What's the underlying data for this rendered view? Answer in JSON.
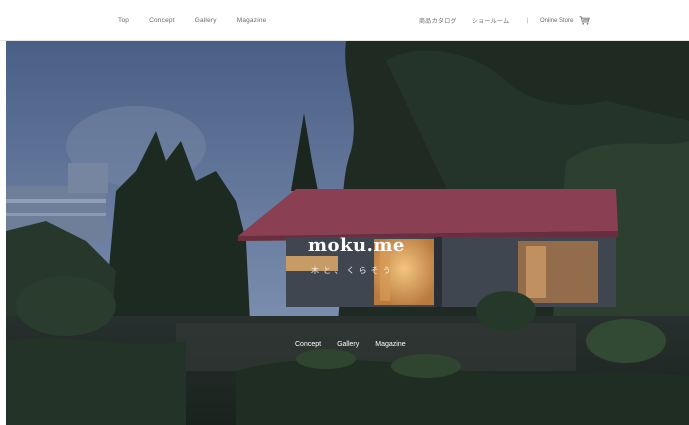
{
  "header": {
    "nav_left": [
      "Top",
      "Concept",
      "Gallery",
      "Magazine"
    ],
    "catalog": "商品カタログ",
    "showroom": "ショールーム",
    "separator": "|",
    "online_store": "Online Store",
    "cart_icon": "cart-icon"
  },
  "hero": {
    "brand": "moku.me",
    "tagline": "木と、くらそう",
    "nav": [
      "Concept",
      "Gallery",
      "Magazine"
    ]
  },
  "colors": {
    "sky_top": "#4a5f86",
    "sky_bottom": "#8d9fbd",
    "roof": "#8a3f52",
    "interior_glow": "#e9b06a",
    "forest": "#1e2b24"
  }
}
